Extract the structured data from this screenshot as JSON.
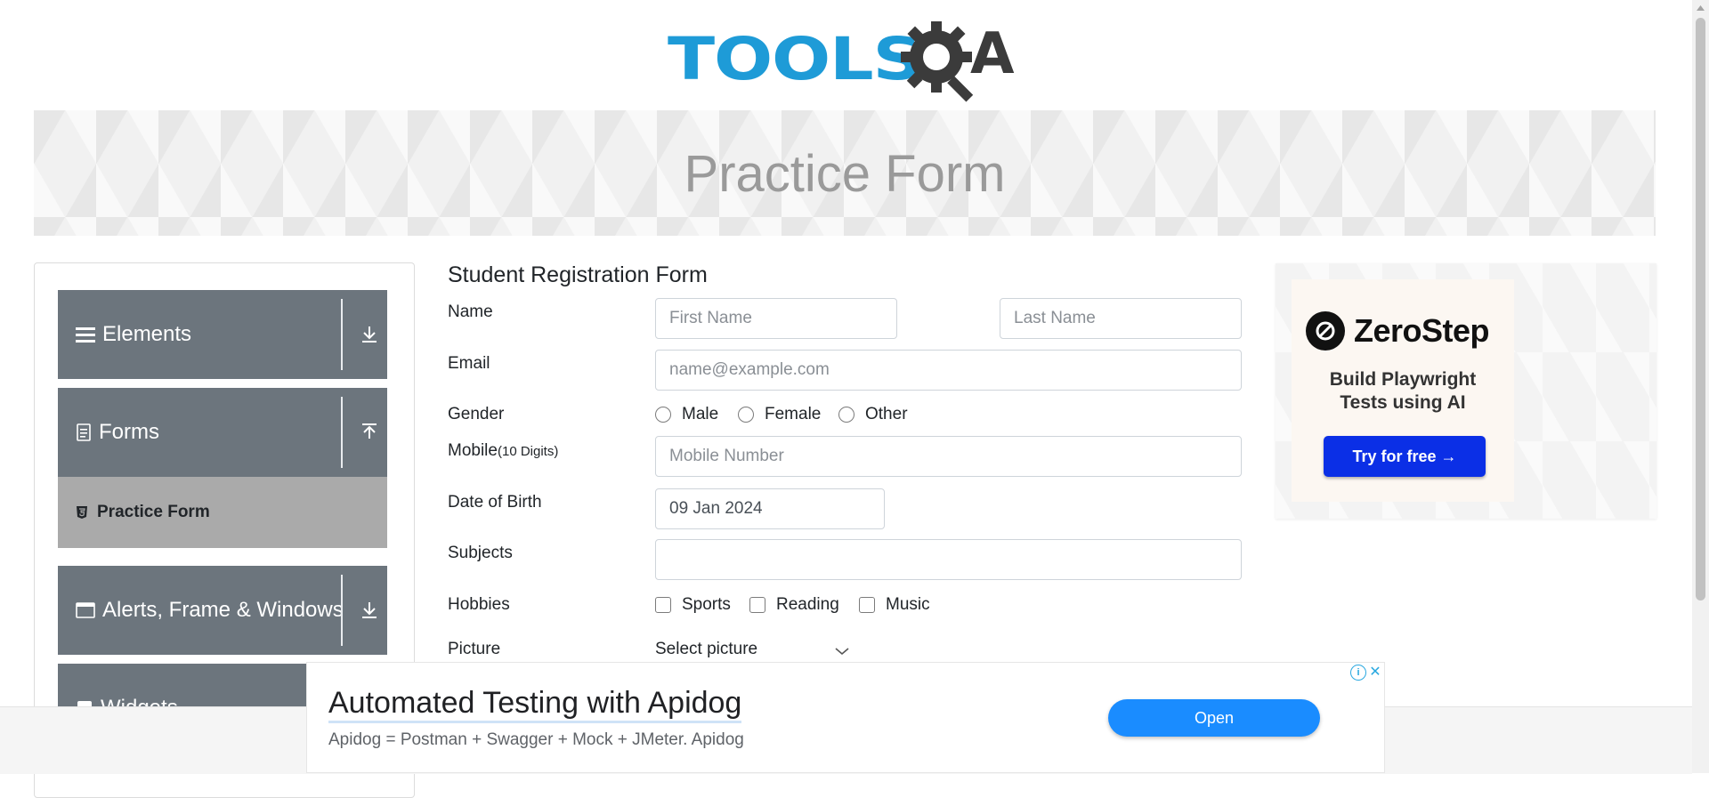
{
  "logo": {
    "tools_text": "TOOLS",
    "qa_text": "A"
  },
  "banner": {
    "title": "Practice Form"
  },
  "sidebar": {
    "groups": [
      {
        "label": "Elements",
        "icon": "hamburger-icon",
        "arrow": "download-arrow-icon"
      },
      {
        "label": "Forms",
        "icon": "document-icon",
        "arrow": "upload-arrow-icon"
      },
      {
        "label": "Alerts, Frame & Windows",
        "icon": "window-icon",
        "arrow": "download-arrow-icon"
      },
      {
        "label": "Widgets",
        "icon": "widget-icon"
      }
    ],
    "forms_items": [
      {
        "label": "Practice Form",
        "icon": "html5-icon",
        "active": true
      }
    ]
  },
  "form": {
    "title": "Student Registration Form",
    "name_label": "Name",
    "first_name_placeholder": "First Name",
    "last_name_placeholder": "Last Name",
    "email_label": "Email",
    "email_placeholder": "name@example.com",
    "gender_label": "Gender",
    "genders": [
      "Male",
      "Female",
      "Other"
    ],
    "mobile_label": "Mobile",
    "mobile_hint": "(10 Digits)",
    "mobile_placeholder": "Mobile Number",
    "dob_label": "Date of Birth",
    "dob_value": "09 Jan 2024",
    "subjects_label": "Subjects",
    "subjects_value": "",
    "hobbies_label": "Hobbies",
    "hobbies": [
      "Sports",
      "Reading",
      "Music"
    ],
    "picture_label": "Picture",
    "picture_button": "Select picture"
  },
  "side_ad": {
    "brand": "ZeroStep",
    "tagline_line1": "Build Playwright",
    "tagline_line2": "Tests using AI",
    "cta": "Try for free →"
  },
  "bottom_ad": {
    "title": "Automated Testing with Apidog",
    "subtitle": "Apidog = Postman + Swagger + Mock + JMeter. Apidog",
    "cta": "Open"
  },
  "colors": {
    "accent_blue": "#1e9bd7",
    "sidebar_gray": "#6c757d",
    "active_item": "#aaaaaa",
    "cta_blue": "#0b2fe6",
    "open_button": "#1a8cff"
  }
}
